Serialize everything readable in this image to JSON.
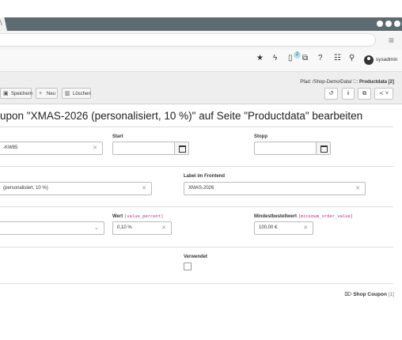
{
  "browser": {
    "tab_label": "\\"
  },
  "topbar": {
    "notification_count": "2",
    "username": "sysadmin",
    "icons": [
      "star-icon",
      "bolt-icon",
      "document-icon",
      "windows-icon",
      "help-icon",
      "list-icon",
      "search-icon",
      "user-icon"
    ]
  },
  "toolbar": {
    "save_label": "Speichern",
    "new_label": "Neu",
    "delete_label": "Löschen"
  },
  "breadcrumb": {
    "prefix": "Pfad: /Shop-Demo/Data/",
    "current": "Productdata [2]"
  },
  "title": "upon \"XMAS-2026 (personalisiert, 10 %)\" auf Seite \"Productdata\" bearbeiten",
  "form": {
    "code_value": "-KW85",
    "start_label": "Start",
    "stop_label": "Stopp",
    "title_value": "(personalisiert, 10 %)",
    "frontend_label": "Label im Frontend",
    "frontend_value": "XMAS-2026",
    "value_label": "Wert",
    "value_code": "[value_percent]",
    "value_value": "0,10 %",
    "min_label": "Mindestbestellwert",
    "min_code": "[minimum_order_value]",
    "min_value": "100,00 €",
    "used_label": "Verwendet"
  },
  "footer": {
    "label": "Shop Coupon",
    "count": "[1]"
  },
  "colors": {
    "window_bar": "#5d6a70",
    "badge": "#b6dde9",
    "code_text": "#b5337b"
  }
}
